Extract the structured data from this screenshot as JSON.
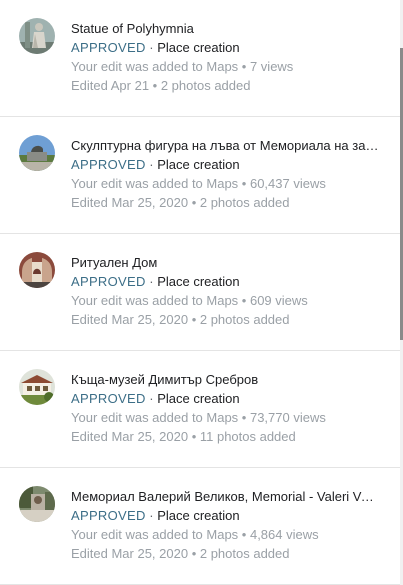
{
  "contributions": [
    {
      "title": "Statue of Polyhymnia",
      "status": "APPROVED",
      "type": "Place creation",
      "line1": "Your edit was added to Maps • 7 views",
      "line2": "Edited Apr 21 • 2 photos added",
      "thumb": "statue-photo"
    },
    {
      "title": "Скулптурна фигура на лъва от Мемориала на за…",
      "status": "APPROVED",
      "type": "Place creation",
      "line1": "Your edit was added to Maps • 60,437 views",
      "line2": "Edited Mar 25, 2020 • 2 photos added",
      "thumb": "lion-sculpture-photo"
    },
    {
      "title": "Ритуален Дом",
      "status": "APPROVED",
      "type": "Place creation",
      "line1": "Your edit was added to Maps • 609 views",
      "line2": "Edited Mar 25, 2020 • 2 photos added",
      "thumb": "ritual-house-photo"
    },
    {
      "title": "Къща-музей Димитър Сребров",
      "status": "APPROVED",
      "type": "Place creation",
      "line1": "Your edit was added to Maps • 73,770 views",
      "line2": "Edited Mar 25, 2020 • 11 photos added",
      "thumb": "house-museum-photo"
    },
    {
      "title": "Мемориал Валерий Великов, Memorial - Valeri Ve…",
      "status": "APPROVED",
      "type": "Place creation",
      "line1": "Your edit was added to Maps • 4,864 views",
      "line2": "Edited Mar 25, 2020 • 2 photos added",
      "thumb": "memorial-photo"
    }
  ],
  "separator": " · ",
  "colors": {
    "approved": "#3c6e87",
    "title": "#202124",
    "meta": "#9aa0a6"
  }
}
